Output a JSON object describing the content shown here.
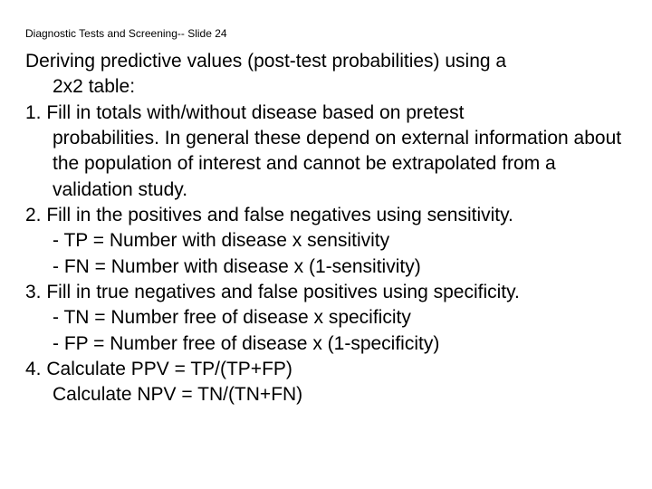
{
  "header": "Diagnostic Tests and Screening-- Slide 24",
  "title": {
    "line1": "Deriving predictive values (post-test probabilities) using a",
    "line2": "2x2 table:"
  },
  "items": [
    {
      "num": "1.",
      "text_first": "Fill in totals with/without disease based on pretest",
      "text_rest": "probabilities.  In general these depend on external information about the population of interest and cannot be extrapolated from a validation study.",
      "subs": []
    },
    {
      "num": "2.",
      "text_first": "Fill in the positives and false negatives using sensitivity.",
      "text_rest": "",
      "subs": [
        "- TP = Number with disease x sensitivity",
        "- FN = Number with disease x (1-sensitivity)"
      ]
    },
    {
      "num": "3.",
      "text_first": "Fill in true negatives and false positives using specificity.",
      "text_rest": "",
      "subs": [
        "- TN = Number free of disease x specificity",
        "- FP = Number free of disease x (1-specificity)"
      ]
    },
    {
      "num": "4.",
      "text_first": "Calculate PPV = TP/(TP+FP)",
      "text_rest": "",
      "subs": [
        "Calculate NPV = TN/(TN+FN)"
      ]
    }
  ]
}
